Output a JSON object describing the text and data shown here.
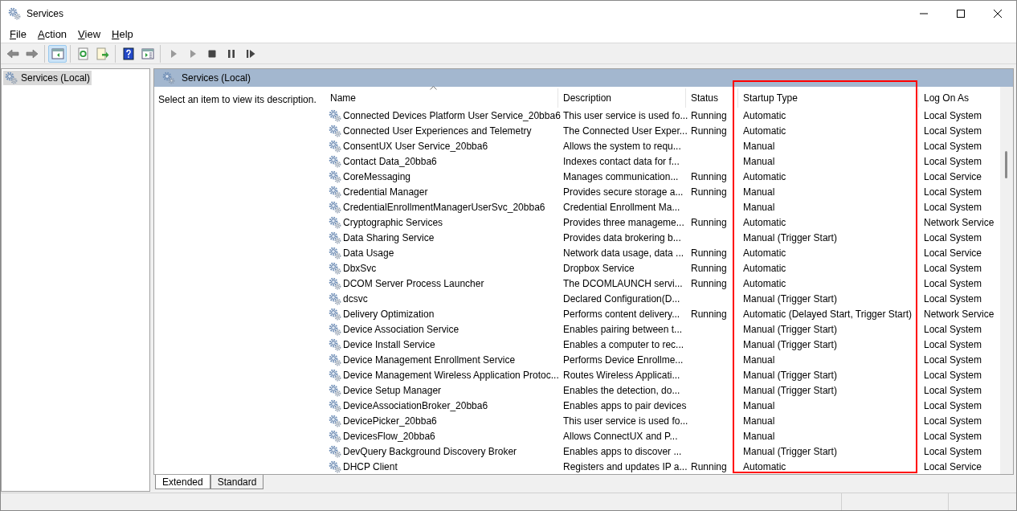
{
  "window": {
    "title": "Services"
  },
  "menu": [
    {
      "label": "File"
    },
    {
      "label": "Action"
    },
    {
      "label": "View"
    },
    {
      "label": "Help"
    }
  ],
  "toolbar": [
    {
      "kind": "back",
      "selected": false
    },
    {
      "kind": "forward",
      "selected": false
    },
    {
      "kind": "sep"
    },
    {
      "kind": "tree",
      "selected": true
    },
    {
      "kind": "sep"
    },
    {
      "kind": "refresh",
      "selected": false
    },
    {
      "kind": "export",
      "selected": false
    },
    {
      "kind": "sep"
    },
    {
      "kind": "help",
      "selected": false
    },
    {
      "kind": "properties",
      "selected": false
    },
    {
      "kind": "sep"
    },
    {
      "kind": "start",
      "selected": false,
      "disabled": true
    },
    {
      "kind": "start",
      "selected": false,
      "disabled": true
    },
    {
      "kind": "stop",
      "selected": false,
      "disabled": false
    },
    {
      "kind": "pause",
      "selected": false,
      "disabled": false
    },
    {
      "kind": "resume",
      "selected": false,
      "disabled": false
    }
  ],
  "tree": [
    {
      "label": "Services (Local)",
      "selected": true
    }
  ],
  "pane_header": "Services (Local)",
  "description_hint": "Select an item to view its description.",
  "columns": [
    {
      "label": "Name",
      "sorted": true
    },
    {
      "label": "Description",
      "sorted": false
    },
    {
      "label": "Status",
      "sorted": false
    },
    {
      "label": "Startup Type",
      "sorted": false,
      "highlighted": true
    },
    {
      "label": "Log On As",
      "sorted": false
    }
  ],
  "rows": [
    {
      "name": "Connected Devices Platform User Service_20bba6",
      "description": "This user service is used fo...",
      "status": "Running",
      "startup_type": "Automatic",
      "log_on_as": "Local System"
    },
    {
      "name": "Connected User Experiences and Telemetry",
      "description": "The Connected User Exper...",
      "status": "Running",
      "startup_type": "Automatic",
      "log_on_as": "Local System"
    },
    {
      "name": "ConsentUX User Service_20bba6",
      "description": "Allows the system to requ...",
      "startup_type": "Manual",
      "log_on_as": "Local System"
    },
    {
      "name": "Contact Data_20bba6",
      "description": "Indexes contact data for f...",
      "startup_type": "Manual",
      "log_on_as": "Local System"
    },
    {
      "name": "CoreMessaging",
      "description": "Manages communication...",
      "status": "Running",
      "startup_type": "Automatic",
      "log_on_as": "Local Service"
    },
    {
      "name": "Credential Manager",
      "description": "Provides secure storage a...",
      "status": "Running",
      "startup_type": "Manual",
      "log_on_as": "Local System"
    },
    {
      "name": "CredentialEnrollmentManagerUserSvc_20bba6",
      "description": "Credential Enrollment Ma...",
      "startup_type": "Manual",
      "log_on_as": "Local System"
    },
    {
      "name": "Cryptographic Services",
      "description": "Provides three manageme...",
      "status": "Running",
      "startup_type": "Automatic",
      "log_on_as": "Network Service"
    },
    {
      "name": "Data Sharing Service",
      "description": "Provides data brokering b...",
      "startup_type": "Manual (Trigger Start)",
      "log_on_as": "Local System"
    },
    {
      "name": "Data Usage",
      "description": "Network data usage, data ...",
      "status": "Running",
      "startup_type": "Automatic",
      "log_on_as": "Local Service"
    },
    {
      "name": "DbxSvc",
      "description": "Dropbox Service",
      "status": "Running",
      "startup_type": "Automatic",
      "log_on_as": "Local System"
    },
    {
      "name": "DCOM Server Process Launcher",
      "description": "The DCOMLAUNCH servi...",
      "status": "Running",
      "startup_type": "Automatic",
      "log_on_as": "Local System"
    },
    {
      "name": "dcsvc",
      "description": "Declared Configuration(D...",
      "startup_type": "Manual (Trigger Start)",
      "log_on_as": "Local System"
    },
    {
      "name": "Delivery Optimization",
      "description": "Performs content delivery...",
      "status": "Running",
      "startup_type": "Automatic (Delayed Start, Trigger Start)",
      "log_on_as": "Network Service"
    },
    {
      "name": "Device Association Service",
      "description": "Enables pairing between t...",
      "startup_type": "Manual (Trigger Start)",
      "log_on_as": "Local System"
    },
    {
      "name": "Device Install Service",
      "description": "Enables a computer to rec...",
      "startup_type": "Manual (Trigger Start)",
      "log_on_as": "Local System"
    },
    {
      "name": "Device Management Enrollment Service",
      "description": "Performs Device Enrollme...",
      "startup_type": "Manual",
      "log_on_as": "Local System"
    },
    {
      "name": "Device Management Wireless Application Protoc...",
      "description": "Routes Wireless Applicati...",
      "startup_type": "Manual (Trigger Start)",
      "log_on_as": "Local System"
    },
    {
      "name": "Device Setup Manager",
      "description": "Enables the detection, do...",
      "startup_type": "Manual (Trigger Start)",
      "log_on_as": "Local System"
    },
    {
      "name": "DeviceAssociationBroker_20bba6",
      "description": "Enables apps to pair devices",
      "startup_type": "Manual",
      "log_on_as": "Local System"
    },
    {
      "name": "DevicePicker_20bba6",
      "description": "This user service is used fo...",
      "startup_type": "Manual",
      "log_on_as": "Local System"
    },
    {
      "name": "DevicesFlow_20bba6",
      "description": "Allows ConnectUX and P...",
      "startup_type": "Manual",
      "log_on_as": "Local System"
    },
    {
      "name": "DevQuery Background Discovery Broker",
      "description": "Enables apps to discover ...",
      "startup_type": "Manual (Trigger Start)",
      "log_on_as": "Local System"
    },
    {
      "name": "DHCP Client",
      "description": "Registers and updates IP a...",
      "status": "Running",
      "startup_type": "Automatic",
      "log_on_as": "Local Service"
    }
  ],
  "view_tabs": [
    {
      "label": "Extended",
      "selected": true
    },
    {
      "label": "Standard",
      "selected": false
    }
  ]
}
